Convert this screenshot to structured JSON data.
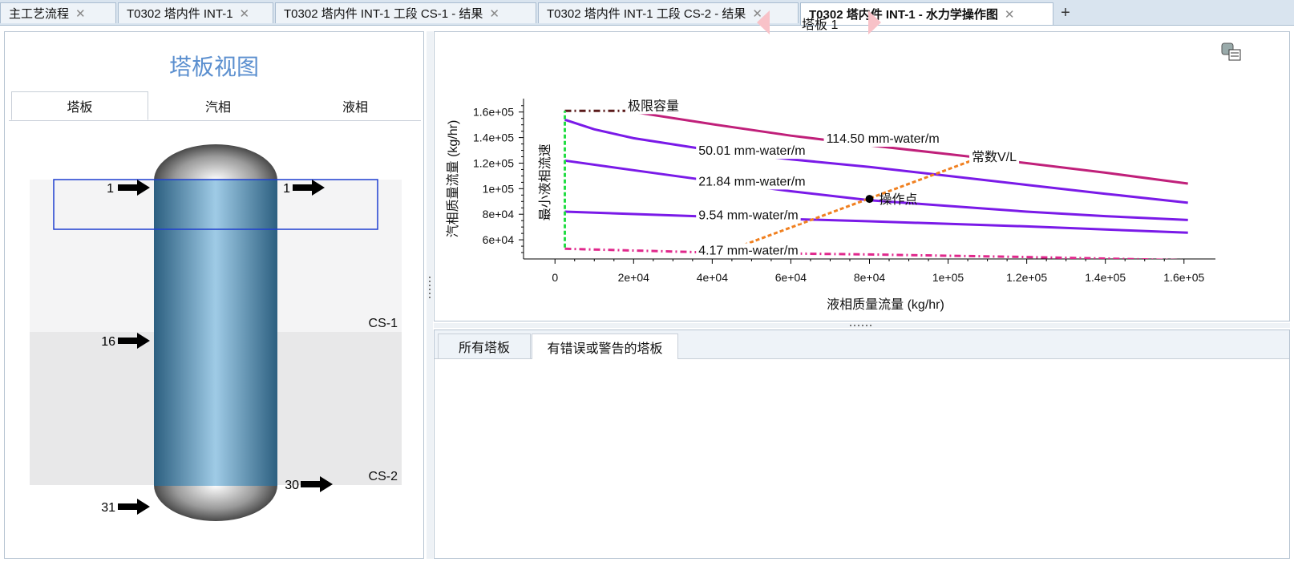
{
  "tabs": [
    {
      "label": "主工艺流程",
      "active": false
    },
    {
      "label": "T0302 塔内件 INT-1",
      "active": false
    },
    {
      "label": "T0302 塔内件 INT-1 工段 CS-1 - 结果",
      "active": false
    },
    {
      "label": "T0302 塔内件 INT-1 工段 CS-2 - 结果",
      "active": false
    },
    {
      "label": "T0302 塔内件 INT-1 - 水力学操作图",
      "active": true
    }
  ],
  "add_tab_symbol": "+",
  "close_symbol": "✕",
  "left": {
    "title": "塔板视图",
    "tabs": [
      "塔板",
      "汽相",
      "液相"
    ],
    "section_labels": [
      "CS-1",
      "CS-2"
    ],
    "stream_labels": {
      "feed_top": "1",
      "draw_top": "1",
      "feed_mid": "16",
      "draw_bottom_side": "30",
      "feed_bottom": "31"
    }
  },
  "right": {
    "tray_label": "塔板 1",
    "prev_icon": "left-triangle-icon",
    "next_icon": "right-triangle-icon",
    "legend_icon": "chart-legend-icon"
  },
  "bottom": {
    "tabs": [
      "所有塔板",
      "有错误或警告的塔板"
    ],
    "active_tab_index": 1
  },
  "chart_data": {
    "type": "line",
    "xlabel": "液相质量流量 (kg/hr)",
    "ylabel": "汽相质量流量 (kg/hr)",
    "xlim": [
      -8000,
      168000
    ],
    "ylim": [
      45000,
      168000
    ],
    "x_ticks": [
      0,
      20000,
      40000,
      60000,
      80000,
      100000,
      120000,
      140000,
      160000
    ],
    "x_tick_labels": [
      "0",
      "2e+04",
      "4e+04",
      "6e+04",
      "8e+04",
      "1e+05",
      "1.2e+05",
      "1.4e+05",
      "1.6e+05"
    ],
    "y_ticks": [
      60000,
      80000,
      100000,
      120000,
      140000,
      160000
    ],
    "y_tick_labels": [
      "6e+04",
      "8e+04",
      "1e+05",
      "1.2e+05",
      "1.4e+05",
      "1.6e+05"
    ],
    "series": [
      {
        "name": "极限容量",
        "style": "dashdot",
        "color": "#5a1a1a",
        "x": [
          2500,
          20000
        ],
        "y": [
          161000,
          161000
        ]
      },
      {
        "name": "114.50 mm-water/m",
        "style": "solid",
        "color": "#c0207a",
        "x": [
          18000,
          40000,
          60000,
          80000,
          100000,
          120000,
          140000,
          161000
        ],
        "y": [
          161000,
          150500,
          141500,
          134000,
          127000,
          120000,
          112500,
          104000
        ]
      },
      {
        "name": "50.01 mm-water/m",
        "style": "solid",
        "color": "#7a1ae8",
        "x": [
          2500,
          10000,
          20000,
          40000,
          60000,
          80000,
          100000,
          120000,
          140000,
          161000
        ],
        "y": [
          154000,
          146500,
          139500,
          130000,
          123000,
          117000,
          110000,
          103000,
          96000,
          89000
        ]
      },
      {
        "name": "21.84 mm-water/m",
        "style": "solid",
        "color": "#7a1ae8",
        "x": [
          2500,
          20000,
          40000,
          60000,
          80000,
          100000,
          120000,
          140000,
          161000
        ],
        "y": [
          122000,
          114500,
          106000,
          98000,
          91000,
          86500,
          82000,
          78500,
          75500
        ]
      },
      {
        "name": "9.54 mm-water/m",
        "style": "solid",
        "color": "#7a1ae8",
        "x": [
          2500,
          40000,
          80000,
          120000,
          161000
        ],
        "y": [
          82000,
          78000,
          74500,
          70500,
          65500
        ]
      },
      {
        "name": "4.17 mm-water/m",
        "style": "dashdot",
        "color": "#e0288c",
        "x": [
          2500,
          40000,
          80000,
          120000,
          161000
        ],
        "y": [
          53000,
          50000,
          48500,
          46500,
          44000
        ]
      },
      {
        "name": "最小液相流速",
        "style": "dashed",
        "color": "#22dd44",
        "x": [
          2500,
          2500
        ],
        "y": [
          54000,
          161000
        ]
      },
      {
        "name": "常数V/L",
        "style": "dashed",
        "color": "#f08020",
        "x": [
          48000,
          106000
        ],
        "y": [
          56000,
          122000
        ]
      }
    ],
    "operating_point": {
      "label": "操作点",
      "x": 80000,
      "y": 92000
    },
    "curve_labels": [
      {
        "text": "极限容量",
        "x": 18500,
        "y": 161500
      },
      {
        "text": "114.50 mm-water/m",
        "x": 69000,
        "y": 136000
      },
      {
        "text": "50.01 mm-water/m",
        "x": 36500,
        "y": 126500
      },
      {
        "text": "21.84 mm-water/m",
        "x": 36500,
        "y": 102500
      },
      {
        "text": "9.54 mm-water/m",
        "x": 36500,
        "y": 76000
      },
      {
        "text": "4.17 mm-water/m",
        "x": 36500,
        "y": 48500
      },
      {
        "text": "常数V/L",
        "x": 106000,
        "y": 121500
      },
      {
        "text": "最小液相流速",
        "x": -1500,
        "y": 105000,
        "vertical": true
      }
    ]
  }
}
